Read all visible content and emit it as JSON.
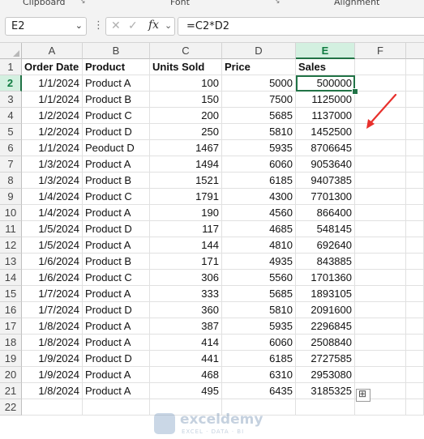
{
  "ribbon": {
    "groups": [
      "Clipboard",
      "Font",
      "Alignment"
    ]
  },
  "formula_bar": {
    "name_box": "E2",
    "cancel_icon": "cancel-icon",
    "enter_icon": "check-icon",
    "fx_label": "fx",
    "formula": "=C2*D2"
  },
  "columns": [
    "A",
    "B",
    "C",
    "D",
    "E",
    "F"
  ],
  "selected_cell": "E2",
  "headers": [
    "Order Date",
    "Product",
    "Units Sold",
    "Price",
    "Sales"
  ],
  "rows": [
    {
      "n": "2",
      "date": "1/1/2024",
      "product": "Product A",
      "units": "100",
      "price": "5000",
      "sales": "500000"
    },
    {
      "n": "3",
      "date": "1/1/2024",
      "product": "Product B",
      "units": "150",
      "price": "7500",
      "sales": "1125000"
    },
    {
      "n": "4",
      "date": "1/2/2024",
      "product": "Product C",
      "units": "200",
      "price": "5685",
      "sales": "1137000"
    },
    {
      "n": "5",
      "date": "1/2/2024",
      "product": "Product D",
      "units": "250",
      "price": "5810",
      "sales": "1452500"
    },
    {
      "n": "6",
      "date": "1/1/2024",
      "product": "Peoduct D",
      "units": "1467",
      "price": "5935",
      "sales": "8706645"
    },
    {
      "n": "7",
      "date": "1/3/2024",
      "product": "Product A",
      "units": "1494",
      "price": "6060",
      "sales": "9053640"
    },
    {
      "n": "8",
      "date": "1/3/2024",
      "product": "Product B",
      "units": "1521",
      "price": "6185",
      "sales": "9407385"
    },
    {
      "n": "9",
      "date": "1/4/2024",
      "product": "Product C",
      "units": "1791",
      "price": "4300",
      "sales": "7701300"
    },
    {
      "n": "10",
      "date": "1/4/2024",
      "product": "Product A",
      "units": "190",
      "price": "4560",
      "sales": "866400"
    },
    {
      "n": "11",
      "date": "1/5/2024",
      "product": "Product D",
      "units": "117",
      "price": "4685",
      "sales": "548145"
    },
    {
      "n": "12",
      "date": "1/5/2024",
      "product": "Product A",
      "units": "144",
      "price": "4810",
      "sales": "692640"
    },
    {
      "n": "13",
      "date": "1/6/2024",
      "product": "Product B",
      "units": "171",
      "price": "4935",
      "sales": "843885"
    },
    {
      "n": "14",
      "date": "1/6/2024",
      "product": "Product C",
      "units": "306",
      "price": "5560",
      "sales": "1701360"
    },
    {
      "n": "15",
      "date": "1/7/2024",
      "product": "Product A",
      "units": "333",
      "price": "5685",
      "sales": "1893105"
    },
    {
      "n": "16",
      "date": "1/7/2024",
      "product": "Product D",
      "units": "360",
      "price": "5810",
      "sales": "2091600"
    },
    {
      "n": "17",
      "date": "1/8/2024",
      "product": "Product A",
      "units": "387",
      "price": "5935",
      "sales": "2296845"
    },
    {
      "n": "18",
      "date": "1/8/2024",
      "product": "Product A",
      "units": "414",
      "price": "6060",
      "sales": "2508840"
    },
    {
      "n": "19",
      "date": "1/9/2024",
      "product": "Product D",
      "units": "441",
      "price": "6185",
      "sales": "2727585"
    },
    {
      "n": "20",
      "date": "1/9/2024",
      "product": "Product A",
      "units": "468",
      "price": "6310",
      "sales": "2953080"
    },
    {
      "n": "21",
      "date": "1/8/2024",
      "product": "Product A",
      "units": "495",
      "price": "6435",
      "sales": "3185325"
    }
  ],
  "watermark": {
    "brand": "exceldemy",
    "tagline": "EXCEL · DATA · BI"
  },
  "colors": {
    "accent": "#217346",
    "arrow": "#e8302c"
  }
}
